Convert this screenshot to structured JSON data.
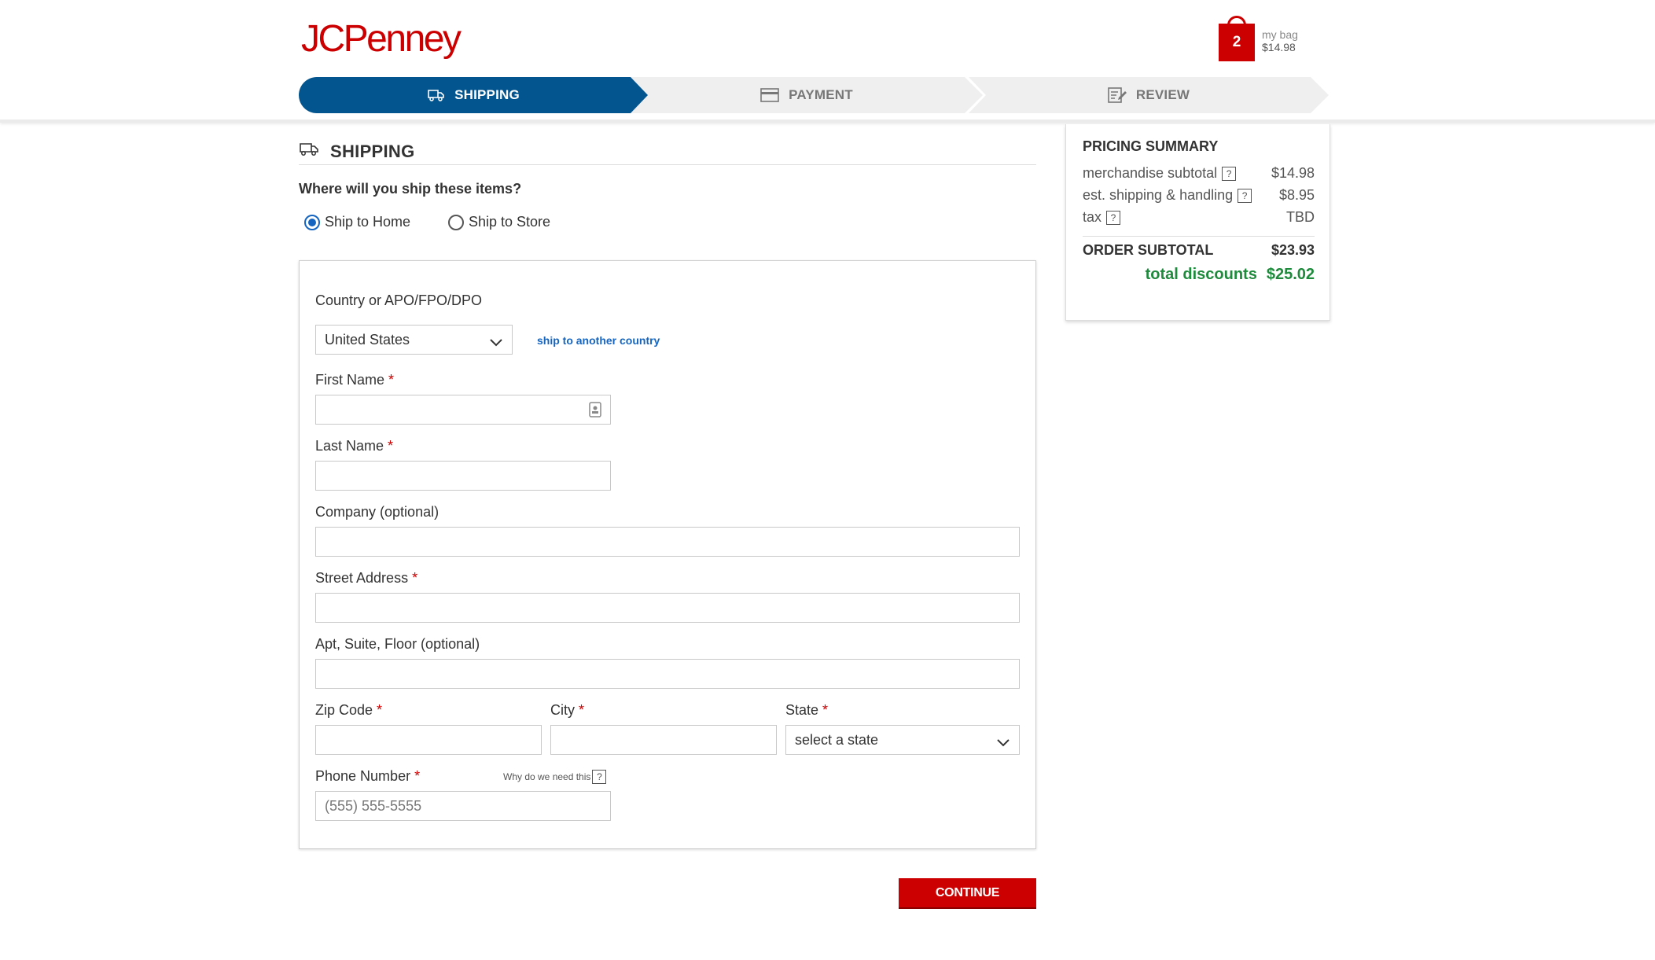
{
  "header": {
    "logo_text": "JCPenney",
    "bag": {
      "count": "2",
      "label": "my bag",
      "amount": "$14.98"
    }
  },
  "steps": [
    {
      "label": "SHIPPING",
      "icon": "truck-icon",
      "active": true
    },
    {
      "label": "PAYMENT",
      "icon": "credit-card-icon",
      "active": false
    },
    {
      "label": "REVIEW",
      "icon": "edit-document-icon",
      "active": false
    }
  ],
  "shipping": {
    "title": "SHIPPING",
    "question": "Where will you ship these items?",
    "options": [
      {
        "label": "Ship to Home",
        "selected": true
      },
      {
        "label": "Ship to Store",
        "selected": false
      }
    ]
  },
  "form": {
    "country_label": "Country or APO/FPO/DPO",
    "country_value": "United States",
    "other_country_link": "ship to another country",
    "first_name_label": "First Name",
    "last_name_label": "Last Name",
    "company_label": "Company (optional)",
    "street_label": "Street Address",
    "apt_label": "Apt, Suite, Floor (optional)",
    "zip_label": "Zip Code",
    "city_label": "City",
    "state_label": "State",
    "state_value": "select a state",
    "phone_label": "Phone Number",
    "phone_placeholder": "(555) 555-5555",
    "why_text": "Why do we need this",
    "required_mark": "*",
    "help_mark": "?"
  },
  "continue_label": "CONTINUE",
  "pricing": {
    "title": "PRICING SUMMARY",
    "rows": [
      {
        "label": "merchandise subtotal",
        "value": "$14.98"
      },
      {
        "label": "est. shipping & handling",
        "value": "$8.95"
      },
      {
        "label": "tax",
        "value": "TBD"
      }
    ],
    "subtotal_label": "ORDER SUBTOTAL",
    "subtotal_value": "$23.93",
    "discount_label": "total discounts",
    "discount_value": "$25.02"
  },
  "colors": {
    "brand_red": "#cc0000",
    "active_step": "#02558f",
    "link_blue": "#1565c0",
    "discount_green": "#1e8a3c"
  }
}
